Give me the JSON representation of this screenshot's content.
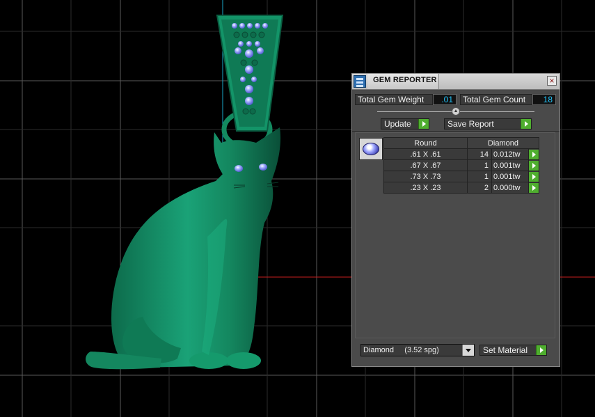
{
  "panel": {
    "title": "GEM REPORTER",
    "close_label": "×",
    "total_gem_weight_label": "Total Gem Weight",
    "total_gem_weight_value": ".01",
    "total_gem_count_label": "Total Gem Count",
    "total_gem_count_value": "18",
    "update_label": "Update",
    "save_report_label": "Save Report",
    "table": {
      "headers": [
        "Round",
        "Diamond"
      ],
      "rows": [
        {
          "size": ".61 X .61",
          "count": "14",
          "weight": "0.012tw"
        },
        {
          "size": ".67 X .67",
          "count": "1",
          "weight": "0.001tw"
        },
        {
          "size": ".73 X .73",
          "count": "1",
          "weight": "0.001tw"
        },
        {
          "size": ".23 X .23",
          "count": "2",
          "weight": "0.000tw"
        }
      ]
    },
    "material_select_value": "Diamond     (3.52 spg)",
    "set_material_label": "Set Material"
  },
  "colors": {
    "model_green": "#169669",
    "gem_blue": "#7c8cff",
    "value_text": "#22c8ff",
    "accent_button": "#4fae2f",
    "viewport_bg": "#000000",
    "grid_line": "#5a5a5a",
    "axis_red": "#c81e1e",
    "axis_cyan": "#1aa7c8"
  },
  "icons": [
    "gem-reporter-app-icon",
    "close-icon",
    "play-arrow-icon",
    "dropdown-arrow-icon",
    "slider-knob-icon",
    "round-gem-icon"
  ]
}
